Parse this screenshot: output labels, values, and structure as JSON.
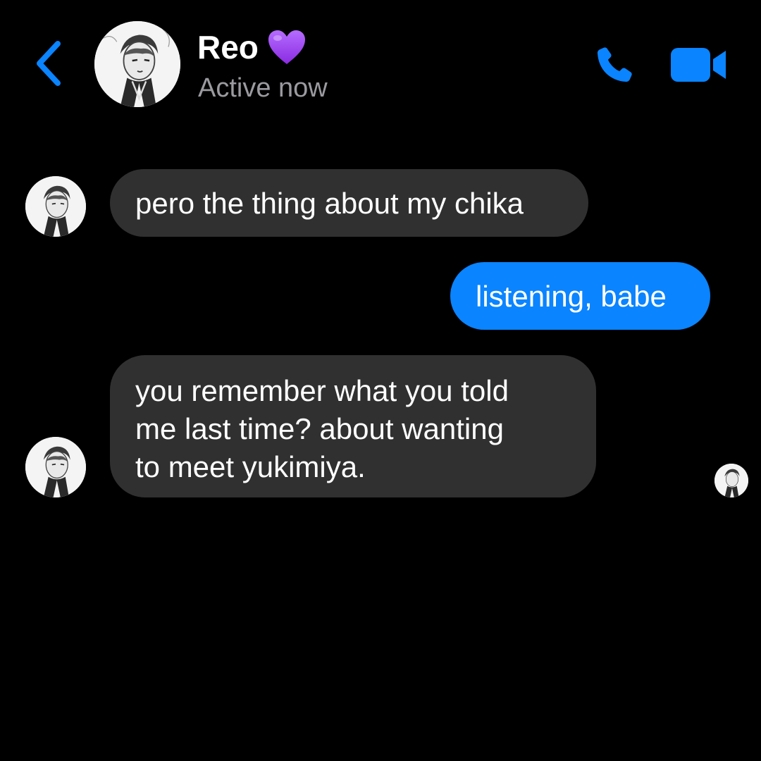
{
  "header": {
    "contact_name": "Reo",
    "name_emoji": "💜",
    "status": "Active now",
    "back_icon": "chevron-left-icon",
    "call_icon": "phone-icon",
    "video_icon": "video-camera-icon",
    "accent_color": "#0a84ff"
  },
  "messages": [
    {
      "direction": "incoming",
      "text": "pero the thing about my chika"
    },
    {
      "direction": "outgoing",
      "text": "listening, babe"
    },
    {
      "direction": "incoming",
      "lines": [
        "you remember what you told",
        "me last time? about wanting",
        "to meet yukimiya."
      ]
    }
  ],
  "colors": {
    "background": "#000000",
    "incoming_bubble": "#303030",
    "outgoing_bubble": "#0a84ff",
    "status_text": "#9a9a9f"
  }
}
